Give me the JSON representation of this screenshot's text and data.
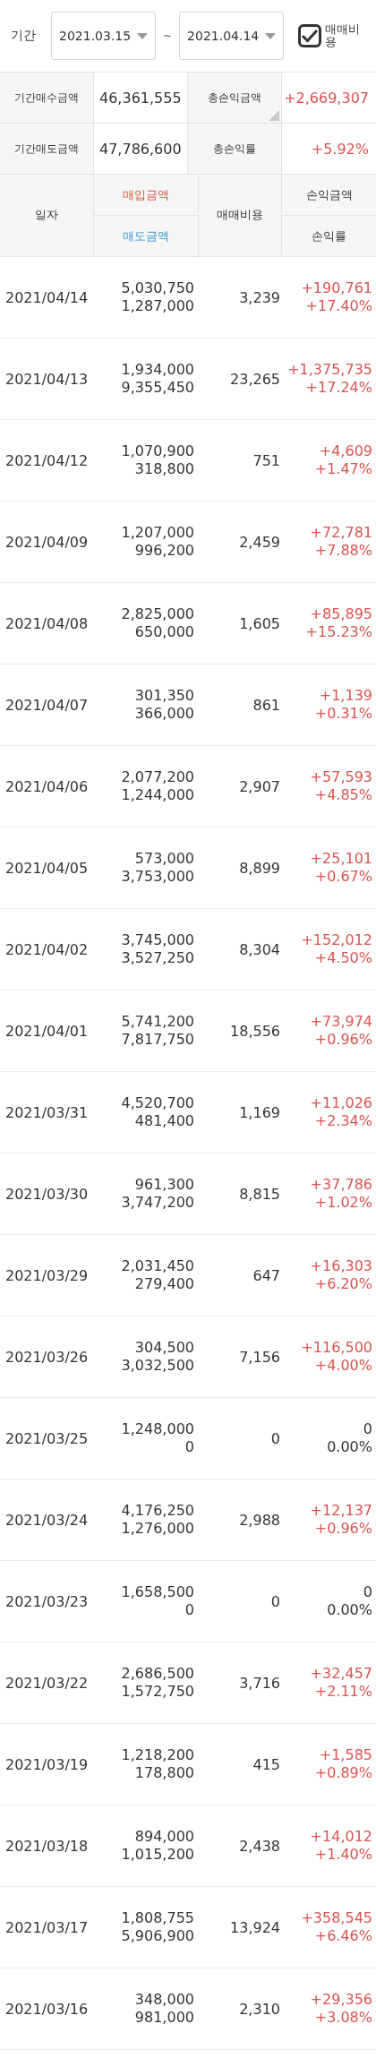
{
  "filter": {
    "label": "기간",
    "start": "2021.03.15",
    "separator": "~",
    "end": "2021.04.14",
    "fee_checkbox": {
      "label": "매매비용",
      "checked": true
    }
  },
  "summary": [
    {
      "label": "기간매수금액",
      "value": "46,361,555",
      "positive": false
    },
    {
      "label": "총손익금액",
      "value": "+2,669,307",
      "positive": true
    },
    {
      "label": "기간매도금액",
      "value": "47,786,600",
      "positive": false
    },
    {
      "label": "총손익률",
      "value": "+5.92%",
      "positive": true
    }
  ],
  "columns": {
    "date": "일자",
    "buy": "매입금액",
    "sell": "매도금액",
    "fee": "매매비용",
    "profit": "손익금액",
    "rate": "손익률"
  },
  "rows": [
    {
      "date": "2021/04/14",
      "buy": "5,030,750",
      "sell": "1,287,000",
      "fee": "3,239",
      "profit": "+190,761",
      "rate": "+17.40%",
      "positive": true
    },
    {
      "date": "2021/04/13",
      "buy": "1,934,000",
      "sell": "9,355,450",
      "fee": "23,265",
      "profit": "+1,375,735",
      "rate": "+17.24%",
      "positive": true
    },
    {
      "date": "2021/04/12",
      "buy": "1,070,900",
      "sell": "318,800",
      "fee": "751",
      "profit": "+4,609",
      "rate": "+1.47%",
      "positive": true
    },
    {
      "date": "2021/04/09",
      "buy": "1,207,000",
      "sell": "996,200",
      "fee": "2,459",
      "profit": "+72,781",
      "rate": "+7.88%",
      "positive": true
    },
    {
      "date": "2021/04/08",
      "buy": "2,825,000",
      "sell": "650,000",
      "fee": "1,605",
      "profit": "+85,895",
      "rate": "+15.23%",
      "positive": true
    },
    {
      "date": "2021/04/07",
      "buy": "301,350",
      "sell": "366,000",
      "fee": "861",
      "profit": "+1,139",
      "rate": "+0.31%",
      "positive": true
    },
    {
      "date": "2021/04/06",
      "buy": "2,077,200",
      "sell": "1,244,000",
      "fee": "2,907",
      "profit": "+57,593",
      "rate": "+4.85%",
      "positive": true
    },
    {
      "date": "2021/04/05",
      "buy": "573,000",
      "sell": "3,753,000",
      "fee": "8,899",
      "profit": "+25,101",
      "rate": "+0.67%",
      "positive": true
    },
    {
      "date": "2021/04/02",
      "buy": "3,745,000",
      "sell": "3,527,250",
      "fee": "8,304",
      "profit": "+152,012",
      "rate": "+4.50%",
      "positive": true
    },
    {
      "date": "2021/04/01",
      "buy": "5,741,200",
      "sell": "7,817,750",
      "fee": "18,556",
      "profit": "+73,974",
      "rate": "+0.96%",
      "positive": true
    },
    {
      "date": "2021/03/31",
      "buy": "4,520,700",
      "sell": "481,400",
      "fee": "1,169",
      "profit": "+11,026",
      "rate": "+2.34%",
      "positive": true
    },
    {
      "date": "2021/03/30",
      "buy": "961,300",
      "sell": "3,747,200",
      "fee": "8,815",
      "profit": "+37,786",
      "rate": "+1.02%",
      "positive": true
    },
    {
      "date": "2021/03/29",
      "buy": "2,031,450",
      "sell": "279,400",
      "fee": "647",
      "profit": "+16,303",
      "rate": "+6.20%",
      "positive": true
    },
    {
      "date": "2021/03/26",
      "buy": "304,500",
      "sell": "3,032,500",
      "fee": "7,156",
      "profit": "+116,500",
      "rate": "+4.00%",
      "positive": true
    },
    {
      "date": "2021/03/25",
      "buy": "1,248,000",
      "sell": "0",
      "fee": "0",
      "profit": "0",
      "rate": "0.00%",
      "positive": false
    },
    {
      "date": "2021/03/24",
      "buy": "4,176,250",
      "sell": "1,276,000",
      "fee": "2,988",
      "profit": "+12,137",
      "rate": "+0.96%",
      "positive": true
    },
    {
      "date": "2021/03/23",
      "buy": "1,658,500",
      "sell": "0",
      "fee": "0",
      "profit": "0",
      "rate": "0.00%",
      "positive": false
    },
    {
      "date": "2021/03/22",
      "buy": "2,686,500",
      "sell": "1,572,750",
      "fee": "3,716",
      "profit": "+32,457",
      "rate": "+2.11%",
      "positive": true
    },
    {
      "date": "2021/03/19",
      "buy": "1,218,200",
      "sell": "178,800",
      "fee": "415",
      "profit": "+1,585",
      "rate": "+0.89%",
      "positive": true
    },
    {
      "date": "2021/03/18",
      "buy": "894,000",
      "sell": "1,015,200",
      "fee": "2,438",
      "profit": "+14,012",
      "rate": "+1.40%",
      "positive": true
    },
    {
      "date": "2021/03/17",
      "buy": "1,808,755",
      "sell": "5,906,900",
      "fee": "13,924",
      "profit": "+358,545",
      "rate": "+6.46%",
      "positive": true
    },
    {
      "date": "2021/03/16",
      "buy": "348,000",
      "sell": "981,000",
      "fee": "2,310",
      "profit": "+29,356",
      "rate": "+3.08%",
      "positive": true
    }
  ]
}
